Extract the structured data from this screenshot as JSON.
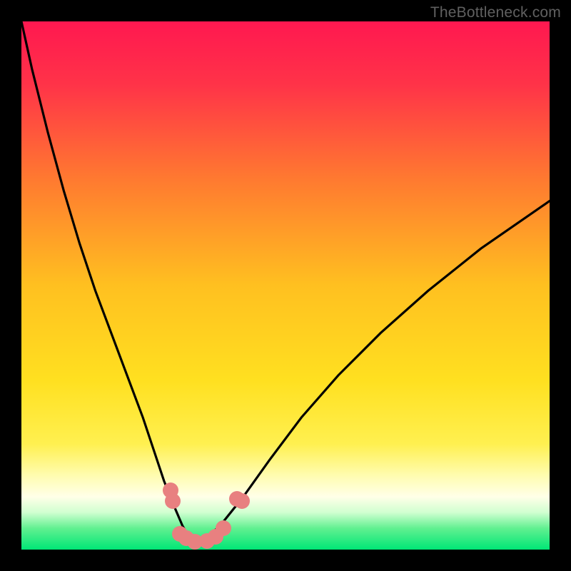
{
  "watermark": "TheBottleneck.com",
  "colors": {
    "top": "#ff1850",
    "upper": "#ff6a30",
    "mid": "#ffd820",
    "pale": "#fffb90",
    "pale2": "#ffffe0",
    "green_mid": "#5ef090",
    "green": "#00e676",
    "curve": "#000000",
    "marker": "#e88080",
    "frame": "#000000"
  },
  "chart_data": {
    "type": "line",
    "title": "",
    "xlabel": "",
    "ylabel": "",
    "xlim": [
      0,
      100
    ],
    "ylim": [
      0,
      100
    ],
    "axes_visible": false,
    "grid": false,
    "background": "vertical-gradient red→yellow→green (bottleneck heatmap)",
    "series": [
      {
        "name": "bottleneck-curve",
        "x": [
          0,
          2,
          5,
          8,
          11,
          14,
          17,
          20,
          23,
          25,
          27,
          29,
          30.5,
          32,
          33.5,
          35,
          38,
          42,
          47,
          53,
          60,
          68,
          77,
          87,
          100
        ],
        "y": [
          100,
          91,
          79,
          68,
          58,
          49,
          41,
          33,
          25,
          19,
          13,
          8,
          4.5,
          2,
          1,
          2,
          5,
          10,
          17,
          25,
          33,
          41,
          49,
          57,
          66
        ]
      }
    ],
    "vertex": {
      "x": 33.5,
      "y": 1
    },
    "markers": [
      {
        "x": 28.2,
        "y": 11.2
      },
      {
        "x": 28.6,
        "y": 9.2
      },
      {
        "x": 30.0,
        "y": 3.0
      },
      {
        "x": 31.2,
        "y": 2.2
      },
      {
        "x": 32.8,
        "y": 1.5
      },
      {
        "x": 35.2,
        "y": 1.6
      },
      {
        "x": 36.8,
        "y": 2.5
      },
      {
        "x": 38.3,
        "y": 4.0
      },
      {
        "x": 40.8,
        "y": 9.6
      },
      {
        "x": 41.8,
        "y": 9.2
      }
    ],
    "annotations": [
      {
        "text": "TheBottleneck.com",
        "position": "top-right",
        "role": "watermark"
      }
    ]
  }
}
